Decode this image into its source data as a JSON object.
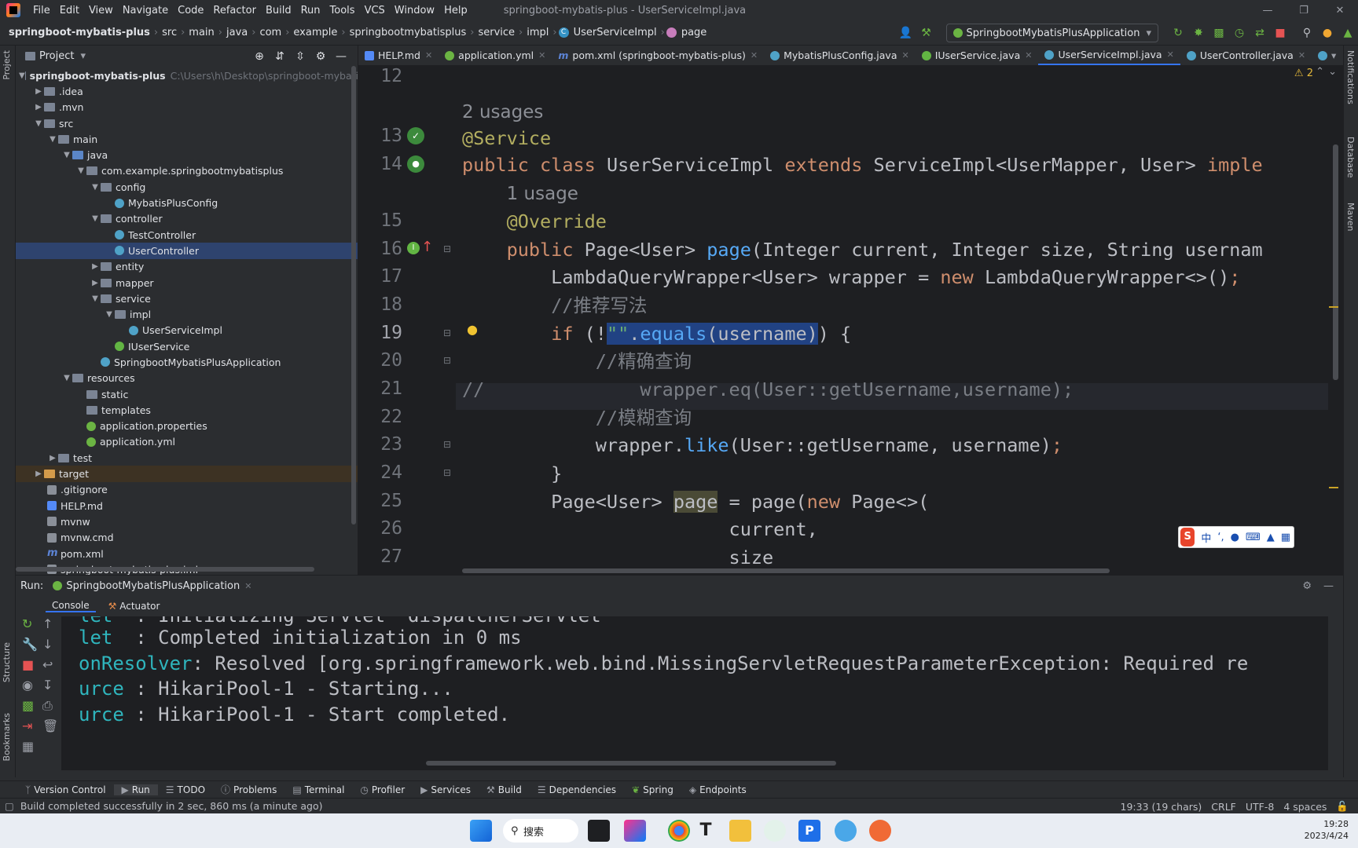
{
  "menubar": {
    "items": [
      "File",
      "Edit",
      "View",
      "Navigate",
      "Code",
      "Refactor",
      "Build",
      "Run",
      "Tools",
      "VCS",
      "Window",
      "Help"
    ],
    "window_title": "springboot-mybatis-plus - UserServiceImpl.java"
  },
  "navbar": {
    "crumbs": [
      "springboot-mybatis-plus",
      "src",
      "main",
      "java",
      "com",
      "example",
      "springbootmybatisplus",
      "service",
      "impl",
      "UserServiceImpl",
      "page"
    ],
    "run_config": "SpringbootMybatisPlusApplication"
  },
  "project": {
    "title": "Project",
    "root_name": "springboot-mybatis-plus",
    "root_path": "C:\\Users\\h\\Desktop\\springboot-mybati",
    "tree": [
      ".idea",
      ".mvn",
      "src",
      "main",
      "java",
      "com.example.springbootmybatisplus",
      "config",
      "MybatisPlusConfig",
      "controller",
      "TestController",
      "UserController",
      "entity",
      "mapper",
      "service",
      "impl",
      "UserServiceImpl",
      "IUserService",
      "SpringbootMybatisPlusApplication",
      "resources",
      "static",
      "templates",
      "application.properties",
      "application.yml",
      "test",
      "target",
      ".gitignore",
      "HELP.md",
      "mvnw",
      "mvnw.cmd",
      "pom.xml",
      "springboot-mybatis-plus.iml"
    ]
  },
  "tabs": [
    "HELP.md",
    "application.yml",
    "pom.xml (springboot-mybatis-plus)",
    "MybatisPlusConfig.java",
    "IUserService.java",
    "UserServiceImpl.java",
    "UserController.java"
  ],
  "editor": {
    "warnings": "2",
    "line_numbers": [
      "12",
      "13",
      "14",
      "15",
      "16",
      "17",
      "18",
      "19",
      "20",
      "21",
      "22",
      "23",
      "24",
      "25",
      "26",
      "27"
    ],
    "usages_2": "2 usages",
    "usages_1": "1 usage",
    "comment_recommend": "//推荐写法",
    "comment_exact": "//精确查询",
    "comment_fuzzy": "//模糊查询",
    "commented_prefix": "//",
    "line_eq": "wrapper.eq(User::getUsername,username);"
  },
  "run": {
    "label": "Run:",
    "config": "SpringbootMybatisPlusApplication",
    "subtabs": [
      "Console",
      "Actuator"
    ],
    "console": [
      {
        "src": "let",
        "msg": "  : Initializing Servlet 'dispatcherServlet'"
      },
      {
        "src": "let",
        "msg": "  : Completed initialization in 0 ms"
      },
      {
        "src": "onResolver",
        "msg": ": Resolved [org.springframework.web.bind.MissingServletRequestParameterException: Required re"
      },
      {
        "src": "urce",
        "msg": " : HikariPool-1 - Starting..."
      },
      {
        "src": "urce",
        "msg": " : HikariPool-1 - Start completed."
      }
    ]
  },
  "bottom_tabs": [
    "Version Control",
    "Run",
    "TODO",
    "Problems",
    "Terminal",
    "Profiler",
    "Services",
    "Build",
    "Dependencies",
    "Spring",
    "Endpoints"
  ],
  "status": {
    "message": "Build completed successfully in 2 sec, 860 ms (a minute ago)",
    "position": "19:33 (19 chars)",
    "line_sep": "CRLF",
    "encoding": "UTF-8",
    "indent": "4 spaces"
  },
  "left_stripe": [
    "Project",
    "Structure",
    "Bookmarks"
  ],
  "right_stripe": [
    "Notifications",
    "Database",
    "Maven"
  ],
  "taskbar": {
    "search": "搜索",
    "time": "19:28",
    "date": "2023/4/24"
  },
  "ime": {
    "label": "中"
  }
}
